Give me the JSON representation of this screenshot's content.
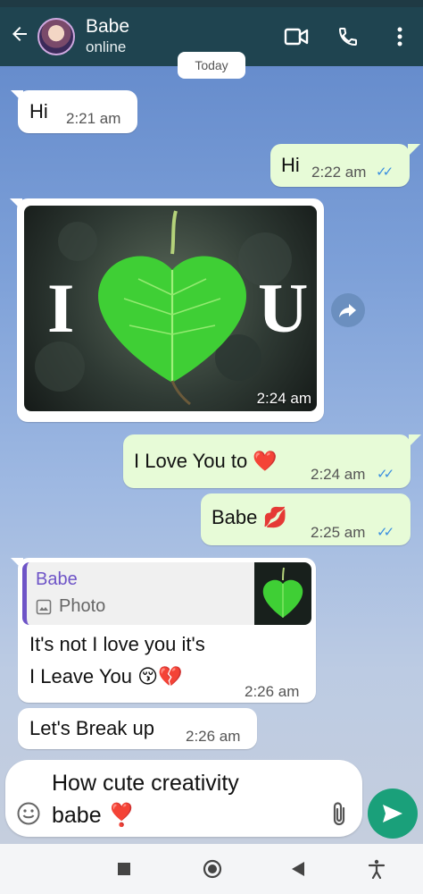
{
  "header": {
    "contact_name": "Babe",
    "contact_status": "online",
    "icons": [
      "back-arrow-icon",
      "video-call-icon",
      "voice-call-icon",
      "more-options-icon"
    ]
  },
  "date_chip": "Today",
  "messages": [
    {
      "direction": "in",
      "text": "Hi",
      "time": "2:21 am"
    },
    {
      "direction": "out",
      "text": "Hi",
      "time": "2:22 am",
      "read": true
    },
    {
      "direction": "in",
      "type": "photo",
      "photo_letters": [
        "I",
        "U"
      ],
      "time": "2:24 am"
    },
    {
      "direction": "out",
      "text": "I Love You to ❤️",
      "time": "2:24 am",
      "read": true
    },
    {
      "direction": "out",
      "text": "Babe 💋",
      "time": "2:25 am",
      "read": true
    },
    {
      "direction": "in",
      "reply_to": {
        "name": "Babe",
        "type_label": "Photo"
      },
      "text_line1": "It's not I love you it's",
      "text_line2": "I Leave You 😚💔",
      "time": "2:26 am"
    },
    {
      "direction": "in",
      "text": "Let's Break up",
      "time": "2:26 am"
    }
  ],
  "composer": {
    "text_line1": "How cute creativity",
    "text_line2": "babe ❣️"
  },
  "colors": {
    "header": "#1f4450",
    "outgoing_bubble": "#e7fbd7",
    "incoming_bubble": "#ffffff",
    "read_ticks": "#3b8fe0",
    "send_button": "#1aa07a",
    "reply_accent": "#6e54c7"
  }
}
